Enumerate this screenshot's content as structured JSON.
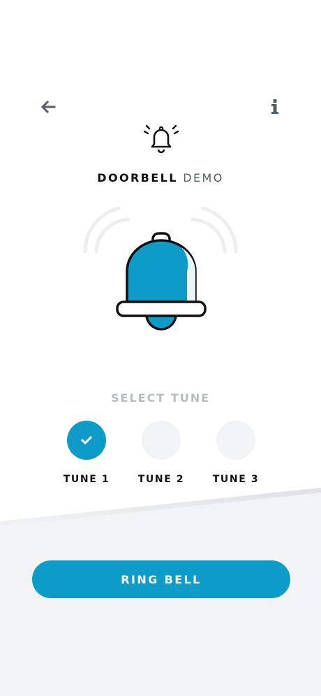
{
  "header": {
    "back_icon": "arrow-left-icon",
    "info_icon": "info-icon",
    "app_icon": "ringing-bell-icon",
    "title_strong": "DOORBELL",
    "title_light": "DEMO"
  },
  "main": {
    "illustration_icon": "bell-illustration",
    "select_label": "SELECT TUNE",
    "tunes": [
      {
        "label": "TUNE 1",
        "selected": true
      },
      {
        "label": "TUNE 2",
        "selected": false
      },
      {
        "label": "TUNE 3",
        "selected": false
      }
    ]
  },
  "footer": {
    "ring_label": "RING BELL"
  },
  "colors": {
    "accent": "#0d9cc7",
    "muted_text": "#b7bcc0",
    "background_gray": "#f2f3f5"
  }
}
